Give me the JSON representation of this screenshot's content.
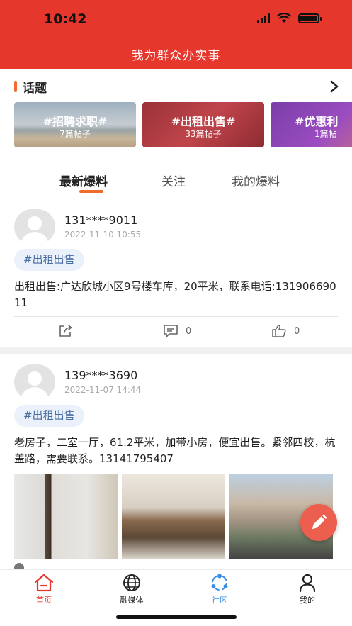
{
  "status": {
    "time": "10:42"
  },
  "header": {
    "title": "我为群众办实事"
  },
  "topics": {
    "title": "话题",
    "cards": [
      {
        "name": "#招聘求职#",
        "count": "7篇帖子"
      },
      {
        "name": "#出租出售#",
        "count": "33篇帖子"
      },
      {
        "name": "#优惠利",
        "count": "1篇帖"
      }
    ]
  },
  "tabs": [
    {
      "label": "最新爆料"
    },
    {
      "label": "关注"
    },
    {
      "label": "我的爆料"
    }
  ],
  "posts": [
    {
      "user": "131****9011",
      "date": "2022-11-10 10:55",
      "tag": "#出租出售",
      "content": "出租出售:广达欣城小区9号楼车库，20平米，联系电话:13190669011",
      "comments": "0",
      "likes": "0"
    },
    {
      "user": "139****3690",
      "date": "2022-11-07 14:44",
      "tag": "#出租出售",
      "content": "老房子，二室一厅，61.2平米，加带小房，便宜出售。紧邻四校，杭盖路，需要联系。13141795407"
    }
  ],
  "bottom_nav": [
    {
      "label": "首页",
      "color": "#e6372c"
    },
    {
      "label": "融媒体",
      "color": "#222222"
    },
    {
      "label": "社区",
      "color": "#3a8ee6"
    },
    {
      "label": "我的",
      "color": "#222222"
    }
  ],
  "colors": {
    "brand": "#e6372c",
    "accent": "#ef6c2c",
    "tag_bg": "#eaf1fb",
    "tag_text": "#4a6ea3"
  }
}
